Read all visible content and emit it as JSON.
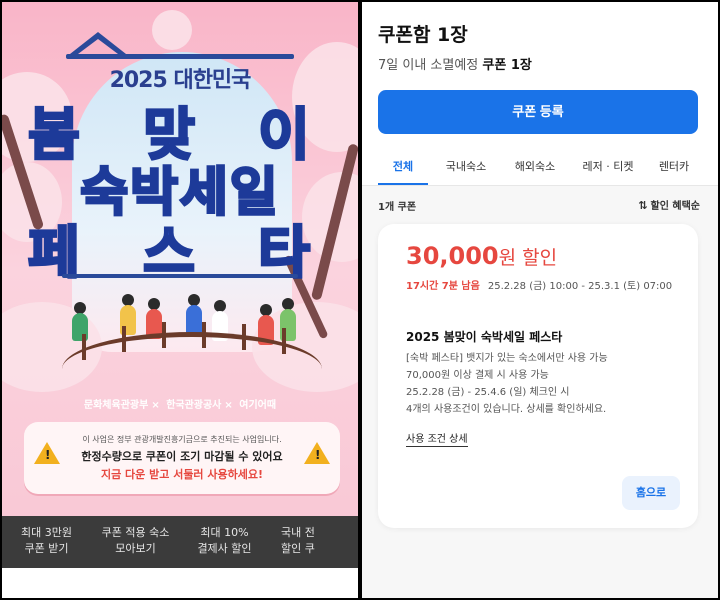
{
  "left": {
    "poster": {
      "year_title": "2025 대한민국",
      "line1": "봄 맞 이",
      "line2": "숙박세일",
      "line3": "페 스 타",
      "sponsors": [
        "문화체육관광부",
        "한국관광공사",
        "여기어때"
      ]
    },
    "notice": {
      "line1": "이 사업은 정부 관광개발진흥기금으로 추진되는 사업입니다.",
      "line2": "한정수량으로 쿠폰이 조기 마감될 수 있어요",
      "line3": "지금 다운 받고 서둘러 사용하세요!"
    },
    "bottom_tabs": [
      {
        "label": "최대 3만원\n쿠폰 받기"
      },
      {
        "label": "쿠폰 적용 숙소\n모아보기"
      },
      {
        "label": "최대 10%\n결제사 할인"
      },
      {
        "label": "국내 전\n할인 쿠"
      }
    ]
  },
  "right": {
    "title": "쿠폰함 1장",
    "subtitle_prefix": "7일 이내 소멸예정",
    "subtitle_strong": "쿠폰 1장",
    "register_button": "쿠폰 등록",
    "tabs": [
      "전체",
      "국내숙소",
      "해외숙소",
      "레저 · 티켓",
      "렌터카"
    ],
    "active_tab": "전체",
    "count": "1개 쿠폰",
    "sort": "할인 혜택순",
    "coupon": {
      "amount": "30,000",
      "amount_suffix": "원 할인",
      "remain": "17시간 7분 남음",
      "period": "25.2.28 (금) 10:00 - 25.3.1 (토) 07:00",
      "name": "2025 봄맞이 숙박세일 페스타",
      "conditions": [
        "[숙박 페스타] 뱃지가 있는 숙소에서만 사용 가능",
        "70,000원 이상 결제 시 사용 가능",
        "25.2.28 (금) - 25.4.6 (일) 체크인 시",
        "4개의 사용조건이 있습니다. 상세를 확인하세요."
      ],
      "detail_link": "사용 조건 상세",
      "home_button": "홈으로"
    }
  },
  "colors": {
    "accent_blue": "#1a73e8",
    "discount_red": "#e6473f",
    "poster_pink": "#f7c6d3",
    "poster_blue": "#2f5bd8"
  }
}
